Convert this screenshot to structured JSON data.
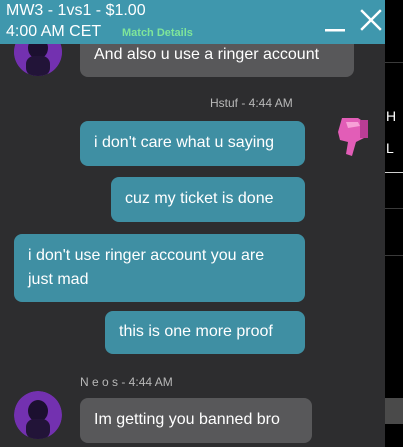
{
  "header": {
    "title": "MW3 - 1vs1 - $1.00",
    "time": "4:00 AM CET",
    "match_details_label": "Match Details"
  },
  "messages": [
    {
      "author": "",
      "time": "",
      "text": "And also u use a ringer account",
      "side": "other"
    },
    {
      "author": "Hstuf",
      "time": "4:44 AM",
      "text": "i don't care what u saying",
      "side": "mine"
    },
    {
      "author": "",
      "time": "",
      "text": "cuz my ticket is done",
      "side": "mine"
    },
    {
      "author": "",
      "time": "",
      "text": "i don't use ringer account you are",
      "text2": "just mad",
      "side": "mine"
    },
    {
      "author": "",
      "time": "",
      "text": "this is one more proof",
      "side": "mine"
    },
    {
      "author": "N e o s",
      "time": "4:44 AM",
      "text": "Im getting you banned bro",
      "side": "other"
    }
  ],
  "meta": {
    "hstuf": "Hstuf - 4:44 AM",
    "neos": "N e o s - 4:44 AM"
  },
  "right_panel": {
    "chars": [
      "H",
      "L"
    ]
  },
  "colors": {
    "header_bg": "#3f97ad",
    "mine_bubble": "#3f8fa3",
    "other_bubble": "#58585a",
    "chat_bg": "#2d2d2f",
    "match_details": "#7fe59a"
  },
  "icons": {
    "minimize": "minimize-icon",
    "close": "close-icon"
  }
}
